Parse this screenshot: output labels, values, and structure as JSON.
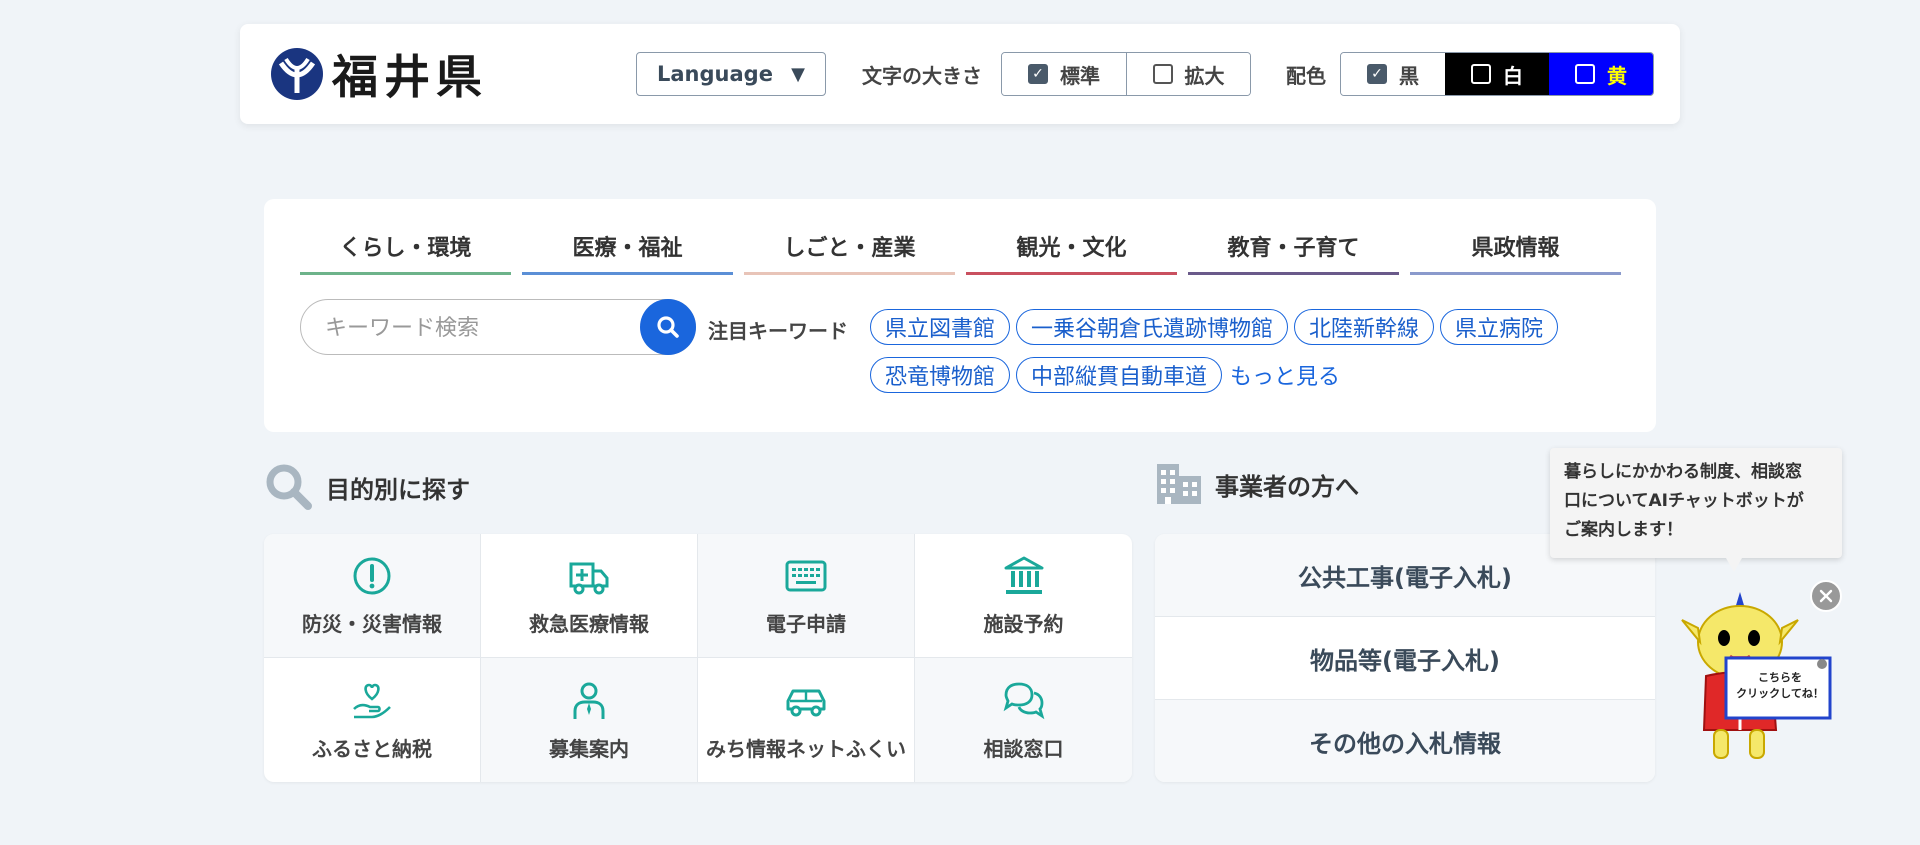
{
  "header": {
    "logo_text": "福井県",
    "language_label": "Language",
    "font_size_label": "文字の大きさ",
    "font_size_options": [
      {
        "label": "標準",
        "checked": true
      },
      {
        "label": "拡大",
        "checked": false
      }
    ],
    "color_label": "配色",
    "color_options": [
      {
        "label": "黒",
        "checked": true
      },
      {
        "label": "白",
        "checked": false
      },
      {
        "label": "黄",
        "checked": false
      }
    ]
  },
  "nav": {
    "tabs": [
      {
        "label": "くらし・環境",
        "color": "#6db38a"
      },
      {
        "label": "医療・福祉",
        "color": "#5b8fd6"
      },
      {
        "label": "しごと・産業",
        "color": "#e8c4b8"
      },
      {
        "label": "観光・文化",
        "color": "#c9505f"
      },
      {
        "label": "教育・子育て",
        "color": "#6a5a8a"
      },
      {
        "label": "県政情報",
        "color": "#8a9acc"
      }
    ]
  },
  "search": {
    "placeholder": "キーワード検索",
    "keywords_label": "注目キーワード",
    "keywords": [
      "県立図書館",
      "一乗谷朝倉氏遺跡博物館",
      "北陸新幹線",
      "県立病院",
      "恐竜博物館",
      "中部縦貫自動車道"
    ],
    "more_label": "もっと見る"
  },
  "purpose": {
    "title": "目的別に探す",
    "items": [
      {
        "label": "防災・災害情報",
        "icon": "alert-icon"
      },
      {
        "label": "救急医療情報",
        "icon": "ambulance-icon"
      },
      {
        "label": "電子申請",
        "icon": "keyboard-icon"
      },
      {
        "label": "施設予約",
        "icon": "building-icon"
      },
      {
        "label": "ふるさと納税",
        "icon": "heart-hand-icon"
      },
      {
        "label": "募集案内",
        "icon": "person-icon"
      },
      {
        "label": "みち情報ネットふくい",
        "icon": "car-icon"
      },
      {
        "label": "相談窓口",
        "icon": "chat-icon"
      }
    ]
  },
  "business": {
    "title": "事業者の方へ",
    "items": [
      "公共工事(電子入札)",
      "物品等(電子入札)",
      "その他の入札情報"
    ]
  },
  "chatbot": {
    "bubble_line1": "暮らしにかかわる制度、相談窓",
    "bubble_line2": "口についてAIチャットボットが",
    "bubble_line3": "ご案内します！",
    "sign_line1": "こちらを",
    "sign_line2": "クリックしてね！"
  },
  "colors": {
    "accent_blue": "#1a66dd",
    "icon_teal": "#1aa89a"
  }
}
